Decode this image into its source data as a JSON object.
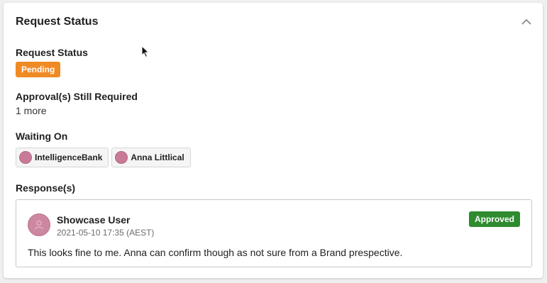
{
  "panel": {
    "title": "Request Status",
    "collapse_icon": "chevron-up-icon"
  },
  "request_status": {
    "label": "Request Status",
    "value": "Pending",
    "color": "#f08a24"
  },
  "approvals": {
    "label": "Approval(s) Still Required",
    "value": "1 more"
  },
  "waiting_on": {
    "label": "Waiting On",
    "items": [
      {
        "label": "IntelligenceBank",
        "icon": "avatar-icon"
      },
      {
        "label": "Anna Littlical",
        "icon": "avatar-icon"
      }
    ]
  },
  "responses": {
    "label": "Response(s)",
    "items": [
      {
        "user": "Showcase User",
        "timestamp": "2021-05-10 17:35 (AEST)",
        "status": "Approved",
        "status_color": "#2e8b2e",
        "comment": "This looks fine to me. Anna can confirm though as not sure from a Brand prespective."
      }
    ]
  }
}
